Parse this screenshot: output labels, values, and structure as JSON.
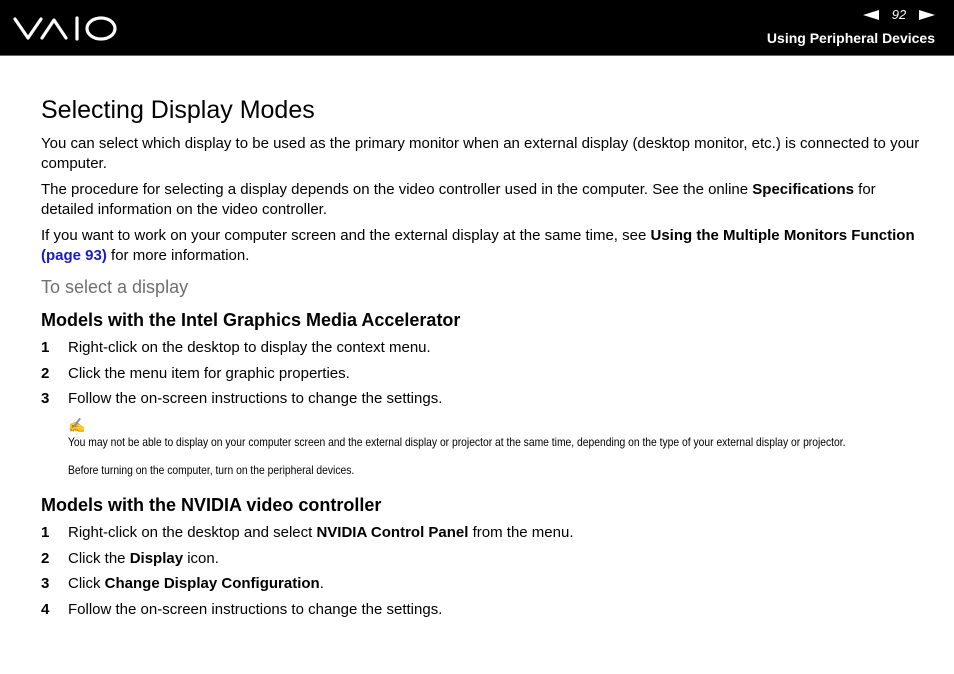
{
  "header": {
    "logo_text": "VAIO",
    "page_number": "92",
    "section_name": "Using Peripheral Devices"
  },
  "page_title": "Selecting Display Modes",
  "intro": {
    "p1": "You can select which display to be used as the primary monitor when an external display (desktop monitor, etc.) is connected to your computer.",
    "p2_before": "The procedure for selecting a display depends on the video controller used in the computer. See the online ",
    "p2_bold": "Specifications",
    "p2_after": " for detailed information on the video controller.",
    "p3_before": "If you want to work on your computer screen and the external display at the same time, see ",
    "p3_bold": "Using the Multiple Monitors Function",
    "p3_link": "(page 93)",
    "p3_after": " for more information."
  },
  "procedure_title": "To select a display",
  "intel": {
    "heading": "Models with the Intel Graphics Media Accelerator",
    "steps": [
      {
        "num": "1",
        "text": "Right-click on the desktop to display the context menu."
      },
      {
        "num": "2",
        "text": "Click the menu item for graphic properties."
      },
      {
        "num": "3",
        "text": "Follow the on-screen instructions to change the settings."
      }
    ],
    "notes": [
      "You may not be able to display on your computer screen and the external display or projector at the same time, depending on the type of your external display or projector.",
      "Before turning on the computer, turn on the peripheral devices."
    ]
  },
  "nvidia": {
    "heading": "Models with the NVIDIA video controller",
    "step1": {
      "num": "1",
      "before": "Right-click on the desktop and select ",
      "bold": "NVIDIA Control Panel",
      "after": " from the menu."
    },
    "step2": {
      "num": "2",
      "before": "Click the ",
      "bold": "Display",
      "after": " icon."
    },
    "step3": {
      "num": "3",
      "before": "Click ",
      "bold": "Change Display Configuration",
      "after": "."
    },
    "step4": {
      "num": "4",
      "text": "Follow the on-screen instructions to change the settings."
    }
  }
}
